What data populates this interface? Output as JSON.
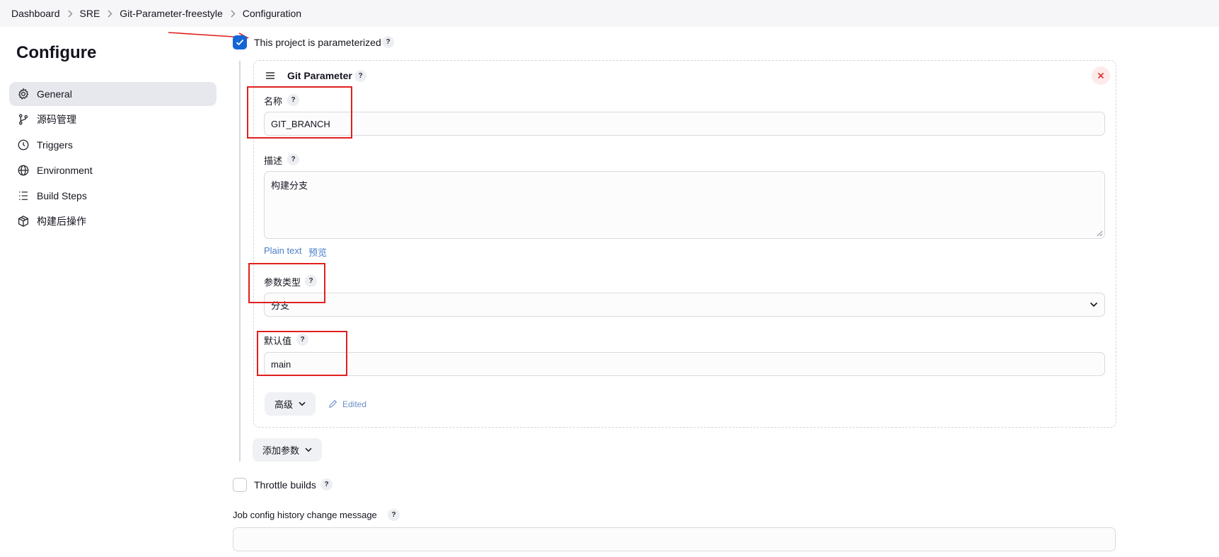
{
  "breadcrumb": [
    "Dashboard",
    "SRE",
    "Git-Parameter-freestyle",
    "Configuration"
  ],
  "page_title": "Configure",
  "sidebar": {
    "items": [
      {
        "label": "General",
        "icon": "gear-icon",
        "active": true
      },
      {
        "label": "源码管理",
        "icon": "source-branch-icon"
      },
      {
        "label": "Triggers",
        "icon": "clock-icon"
      },
      {
        "label": "Environment",
        "icon": "globe-icon"
      },
      {
        "label": "Build Steps",
        "icon": "list-icon"
      },
      {
        "label": "构建后操作",
        "icon": "package-icon"
      }
    ]
  },
  "parameterized": {
    "label": "This project is parameterized",
    "checked": true,
    "help": "?"
  },
  "git_parameter": {
    "title": "Git Parameter",
    "help": "?",
    "name_label": "名称",
    "name_value": "GIT_BRANCH",
    "description_label": "描述",
    "description_value": "构建分支",
    "plain_text_link": "Plain text",
    "preview_link": "预览",
    "param_type_label": "参数类型",
    "param_type_value": "分支",
    "default_label": "默认值",
    "default_value": "main",
    "advanced_button": "高级",
    "edited_label": "Edited"
  },
  "add_param_button": "添加参数",
  "throttle": {
    "label": "Throttle builds",
    "checked": false,
    "help": "?"
  },
  "history": {
    "label": "Job config history change message",
    "help": "?",
    "value": ""
  },
  "colors": {
    "accent": "#1466d6",
    "annotation": "#e0201f",
    "link": "#4a7ec9",
    "active_bg": "#e6e8ee"
  }
}
